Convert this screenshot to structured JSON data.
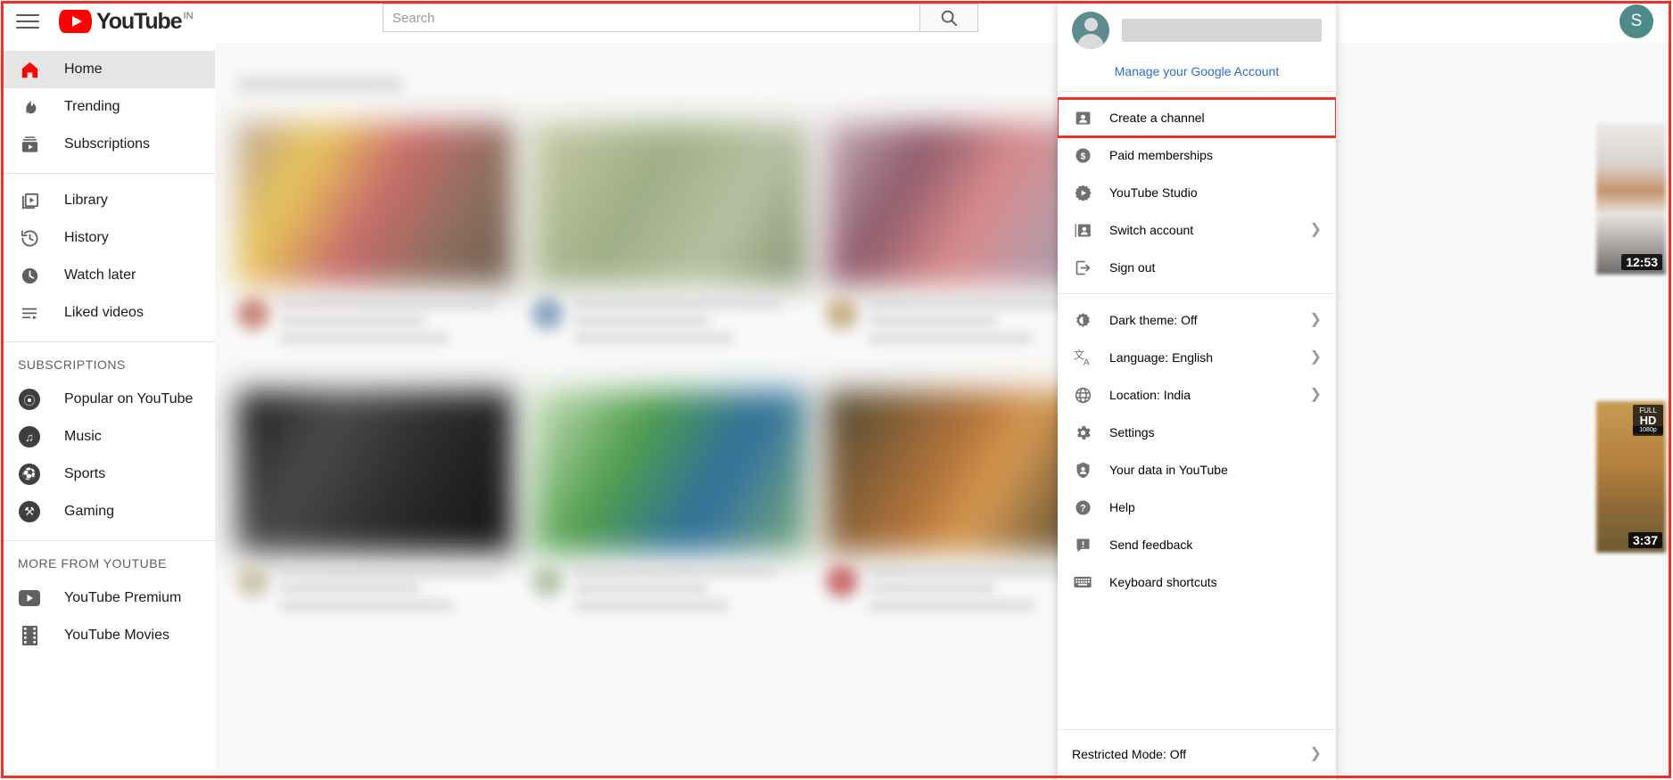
{
  "header": {
    "menu_icon": "hamburger-menu-icon",
    "logo_text": "YouTube",
    "logo_country": "IN",
    "search_placeholder": "Search",
    "search_value": "",
    "search_icon": "search-icon",
    "avatar_initial": "S"
  },
  "sidebar": {
    "primary": [
      {
        "label": "Home",
        "icon": "home-icon",
        "active": true
      },
      {
        "label": "Trending",
        "icon": "trending-flame-icon",
        "active": false
      },
      {
        "label": "Subscriptions",
        "icon": "subscriptions-icon",
        "active": false
      }
    ],
    "library": [
      {
        "label": "Library",
        "icon": "library-icon"
      },
      {
        "label": "History",
        "icon": "history-clock-icon"
      },
      {
        "label": "Watch later",
        "icon": "watch-later-clock-icon"
      },
      {
        "label": "Liked videos",
        "icon": "liked-videos-icon"
      }
    ],
    "subscriptions_header": "SUBSCRIPTIONS",
    "subscriptions": [
      {
        "label": "Popular on YouTube",
        "icon": "popular-channel-avatar"
      },
      {
        "label": "Music",
        "icon": "music-note-avatar"
      },
      {
        "label": "Sports",
        "icon": "sports-ball-avatar"
      },
      {
        "label": "Gaming",
        "icon": "gaming-controller-avatar"
      }
    ],
    "more_header": "MORE FROM YOUTUBE",
    "more": [
      {
        "label": "YouTube Premium",
        "icon": "youtube-premium-icon"
      },
      {
        "label": "YouTube Movies",
        "icon": "youtube-movies-film-icon"
      }
    ]
  },
  "account_menu": {
    "account_name_redacted": "",
    "manage_account_link": "Manage your Google Account",
    "manage_link_color": "#2b6dd6",
    "highlight_color": "#ee3124",
    "group_account": [
      {
        "label": "Create a channel",
        "icon": "person-card-icon",
        "arrow": false,
        "highlighted": true
      },
      {
        "label": "Paid memberships",
        "icon": "dollar-circle-icon",
        "arrow": false,
        "highlighted": false
      },
      {
        "label": "YouTube Studio",
        "icon": "studio-gear-play-icon",
        "arrow": false,
        "highlighted": false
      },
      {
        "label": "Switch account",
        "icon": "switch-account-icon",
        "arrow": true,
        "highlighted": false
      },
      {
        "label": "Sign out",
        "icon": "sign-out-icon",
        "arrow": false,
        "highlighted": false
      }
    ],
    "group_settings": [
      {
        "label": "Dark theme: Off",
        "icon": "dark-theme-brightness-icon",
        "arrow": true
      },
      {
        "label": "Language: English",
        "icon": "language-translate-icon",
        "arrow": true
      },
      {
        "label": "Location: India",
        "icon": "location-globe-icon",
        "arrow": true
      },
      {
        "label": "Settings",
        "icon": "gear-icon",
        "arrow": false
      },
      {
        "label": "Your data in YouTube",
        "icon": "shield-person-icon",
        "arrow": false
      },
      {
        "label": "Help",
        "icon": "help-question-icon",
        "arrow": false
      },
      {
        "label": "Send feedback",
        "icon": "feedback-bubble-icon",
        "arrow": false
      },
      {
        "label": "Keyboard shortcuts",
        "icon": "keyboard-icon",
        "arrow": false
      }
    ],
    "footer": {
      "label": "Restricted Mode: Off",
      "arrow": true
    }
  },
  "rail_videos": [
    {
      "duration": "12:53",
      "badge": ""
    },
    {
      "duration": "3:37",
      "badge": "FULL HD 1080p"
    }
  ]
}
